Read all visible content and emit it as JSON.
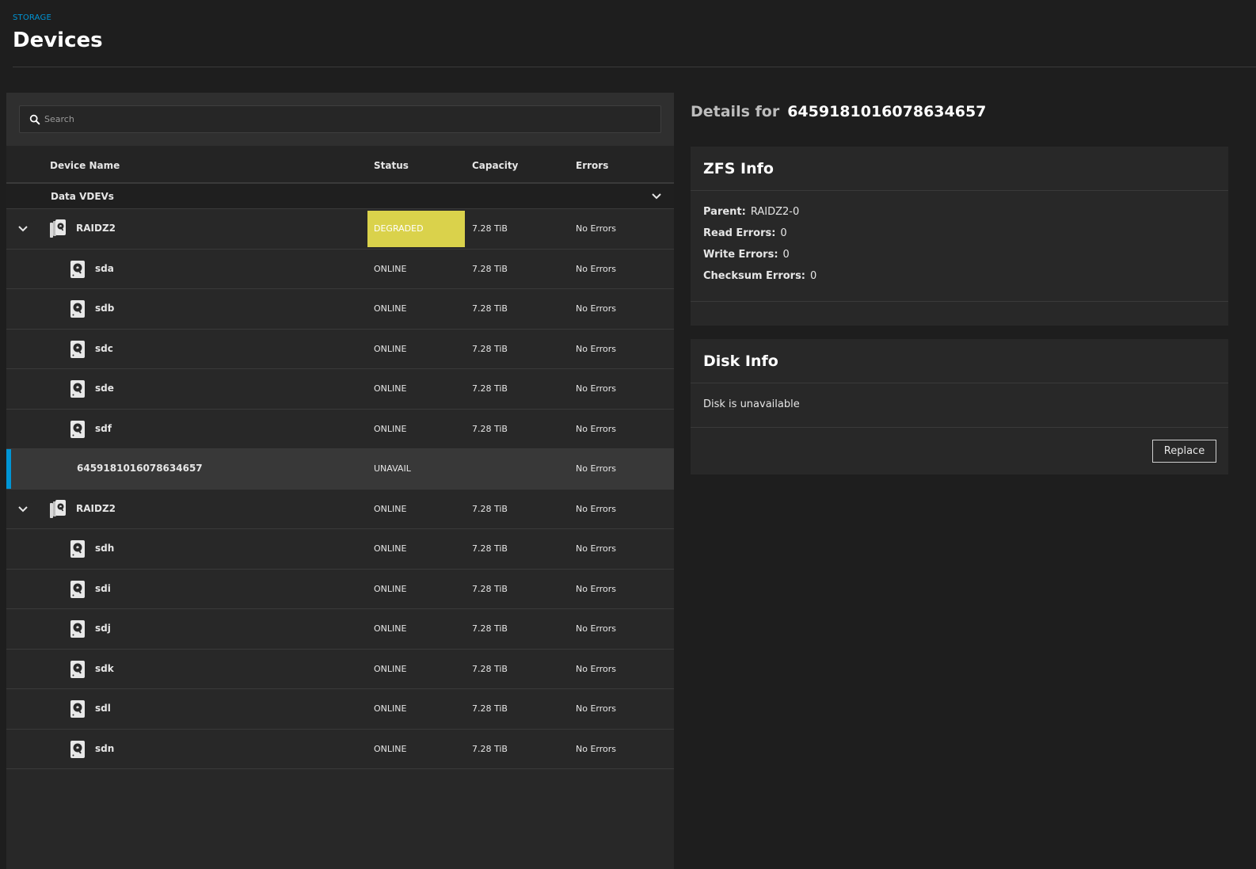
{
  "header": {
    "breadcrumb": "STORAGE",
    "title": "Devices"
  },
  "search": {
    "placeholder": "Search"
  },
  "table": {
    "columns": {
      "device_name": "Device Name",
      "status": "Status",
      "capacity": "Capacity",
      "errors": "Errors"
    },
    "group_label": "Data VDEVs",
    "rows": [
      {
        "kind": "vdev",
        "name": "RAIDZ2",
        "status": "DEGRADED",
        "capacity": "7.28 TiB",
        "errors": "No Errors"
      },
      {
        "kind": "disk",
        "name": "sda",
        "status": "ONLINE",
        "capacity": "7.28 TiB",
        "errors": "No Errors"
      },
      {
        "kind": "disk",
        "name": "sdb",
        "status": "ONLINE",
        "capacity": "7.28 TiB",
        "errors": "No Errors"
      },
      {
        "kind": "disk",
        "name": "sdc",
        "status": "ONLINE",
        "capacity": "7.28 TiB",
        "errors": "No Errors"
      },
      {
        "kind": "disk",
        "name": "sde",
        "status": "ONLINE",
        "capacity": "7.28 TiB",
        "errors": "No Errors"
      },
      {
        "kind": "disk",
        "name": "sdf",
        "status": "ONLINE",
        "capacity": "7.28 TiB",
        "errors": "No Errors"
      },
      {
        "kind": "missing",
        "name": "6459181016078634657",
        "status": "UNAVAIL",
        "capacity": "",
        "errors": "No Errors",
        "selected": true
      },
      {
        "kind": "vdev",
        "name": "RAIDZ2",
        "status": "ONLINE",
        "capacity": "7.28 TiB",
        "errors": "No Errors"
      },
      {
        "kind": "disk",
        "name": "sdh",
        "status": "ONLINE",
        "capacity": "7.28 TiB",
        "errors": "No Errors"
      },
      {
        "kind": "disk",
        "name": "sdi",
        "status": "ONLINE",
        "capacity": "7.28 TiB",
        "errors": "No Errors"
      },
      {
        "kind": "disk",
        "name": "sdj",
        "status": "ONLINE",
        "capacity": "7.28 TiB",
        "errors": "No Errors"
      },
      {
        "kind": "disk",
        "name": "sdk",
        "status": "ONLINE",
        "capacity": "7.28 TiB",
        "errors": "No Errors"
      },
      {
        "kind": "disk",
        "name": "sdl",
        "status": "ONLINE",
        "capacity": "7.28 TiB",
        "errors": "No Errors"
      },
      {
        "kind": "disk",
        "name": "sdn",
        "status": "ONLINE",
        "capacity": "7.28 TiB",
        "errors": "No Errors"
      }
    ]
  },
  "details": {
    "prefix": "Details for",
    "device_id": "6459181016078634657",
    "zfs_info": {
      "title": "ZFS Info",
      "items": [
        {
          "label": "Parent:",
          "value": "RAIDZ2-0"
        },
        {
          "label": "Read Errors:",
          "value": "0"
        },
        {
          "label": "Write Errors:",
          "value": "0"
        },
        {
          "label": "Checksum Errors:",
          "value": "0"
        }
      ]
    },
    "disk_info": {
      "title": "Disk Info",
      "message": "Disk is unavailable",
      "replace_label": "Replace"
    }
  },
  "colors": {
    "accent": "#0095d5",
    "degraded": "#dad24b",
    "background": "#1e1e1e",
    "panel": "#282828"
  }
}
